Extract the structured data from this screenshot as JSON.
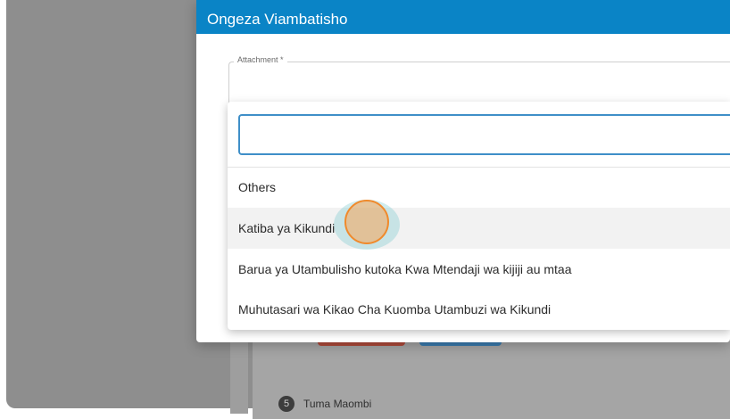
{
  "dialog": {
    "title": "Ongeza Viambatisho",
    "field_label": "Attachment *",
    "search_value": ""
  },
  "options": [
    "Others",
    "Katiba ya Kikundi",
    "Barua ya Utambulisho kutoka Kwa Mtendaji wa kijiji au mtaa",
    "Muhutasari wa Kikao Cha Kuomba Utambuzi wa Kikundi"
  ],
  "hovered_option": "Katiba ya Kikundi",
  "background": {
    "step_number": "5",
    "step_label": "Tuma Maombi"
  },
  "colors": {
    "header": "#0a84c6",
    "focus_border": "#3f8fc8",
    "cursor_highlight": "#f08a2c"
  }
}
